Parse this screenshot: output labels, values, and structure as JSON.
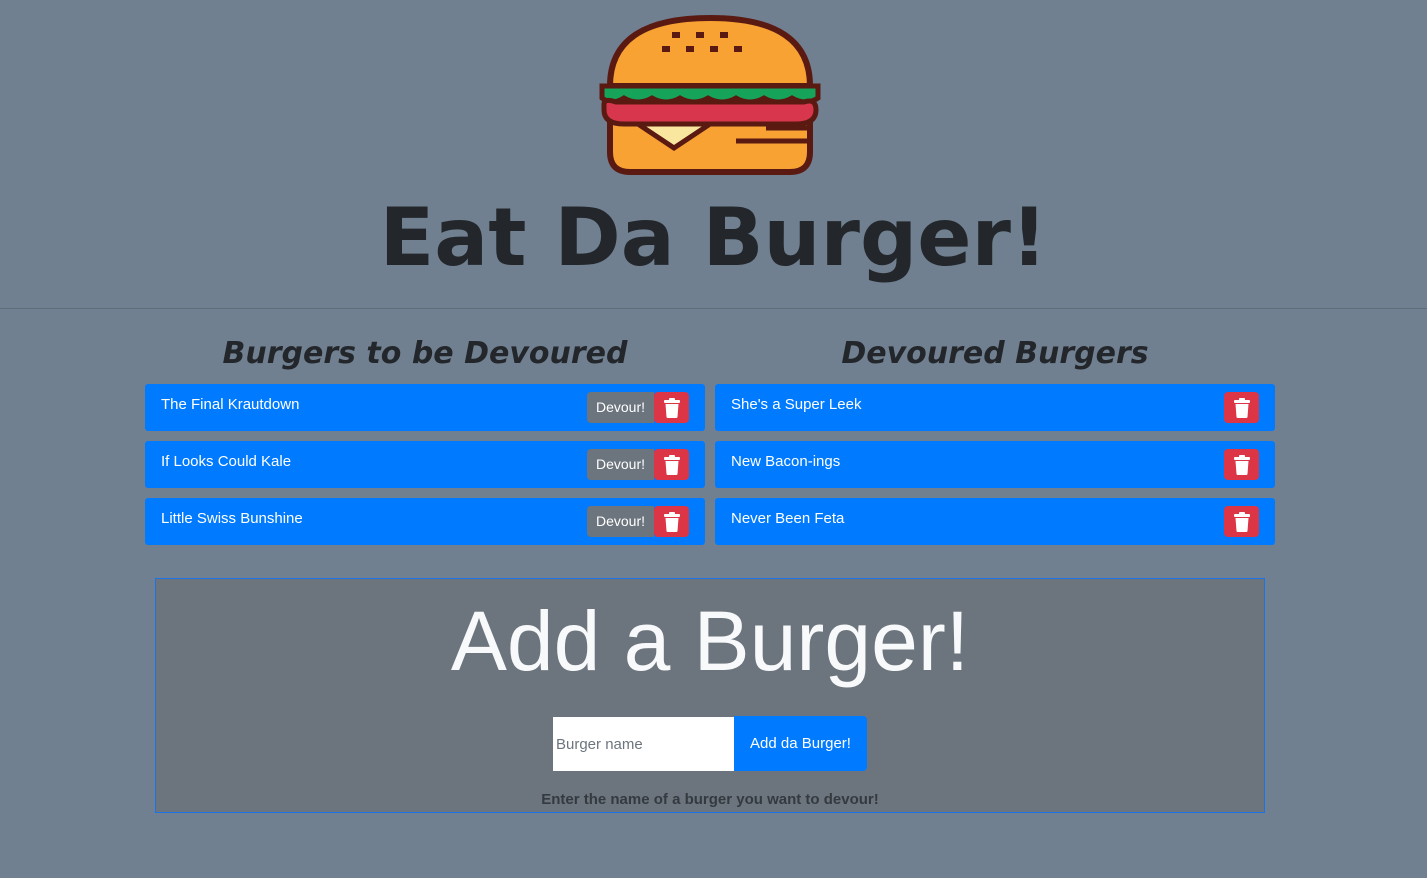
{
  "header": {
    "title": "Eat Da Burger!",
    "logo_icon": "burger-icon"
  },
  "columns": {
    "to_devour": {
      "title": "Burgers to be Devoured",
      "items": [
        {
          "name": "The Final Krautdown",
          "devour_label": "Devour!"
        },
        {
          "name": "If Looks Could Kale",
          "devour_label": "Devour!"
        },
        {
          "name": "Little Swiss Bunshine",
          "devour_label": "Devour!"
        }
      ]
    },
    "devoured": {
      "title": "Devoured Burgers",
      "items": [
        {
          "name": "She's a Super Leek"
        },
        {
          "name": "New Bacon-ings"
        },
        {
          "name": "Never Been Feta"
        }
      ]
    }
  },
  "add_form": {
    "title": "Add a Burger!",
    "input_placeholder": "Burger name",
    "input_value": "",
    "submit_label": "Add da Burger!",
    "help_text": "Enter the name of a burger you want to devour!"
  },
  "colors": {
    "background": "#708090",
    "primary": "#007bff",
    "danger": "#dc3545",
    "secondary": "#6c757d"
  }
}
